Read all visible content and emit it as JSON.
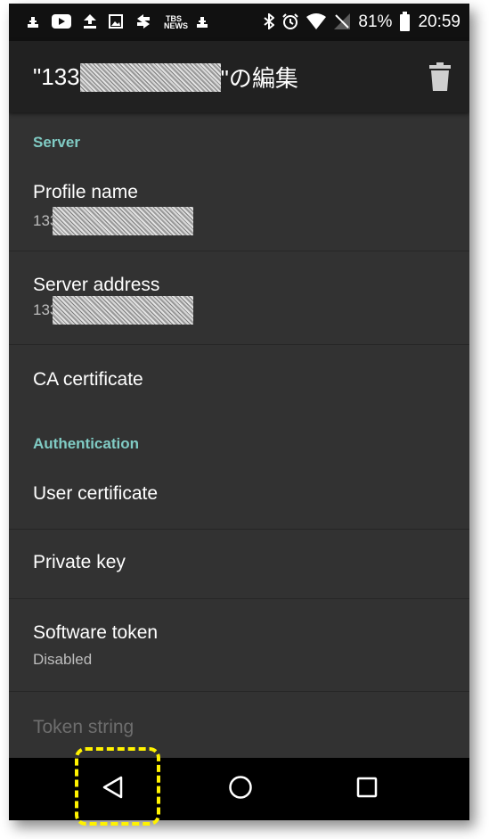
{
  "status_bar": {
    "icons": [
      "notification-icon",
      "youtube-icon",
      "upload-icon",
      "image-icon",
      "sync-icon",
      "tbs-news-icon",
      "notification-icon",
      "bluetooth-icon",
      "alarm-icon",
      "wifi-icon",
      "no-signal-icon",
      "battery-icon"
    ],
    "tbs_label": "TBS NEWS",
    "battery": "81%",
    "time": "20:59"
  },
  "toolbar": {
    "title_prefix": "\"133",
    "title_suffix": "\"の編集",
    "delete_icon": "trash-icon"
  },
  "sections": {
    "server": {
      "header": "Server"
    },
    "auth": {
      "header": "Authentication"
    }
  },
  "items": {
    "profile_name": {
      "title": "Profile name",
      "value_prefix": "133"
    },
    "server_address": {
      "title": "Server address",
      "value_prefix": "133"
    },
    "ca_certificate": {
      "title": "CA certificate"
    },
    "user_certificate": {
      "title": "User certificate"
    },
    "private_key": {
      "title": "Private key"
    },
    "software_token": {
      "title": "Software token",
      "value": "Disabled"
    },
    "token_string": {
      "title": "Token string"
    }
  },
  "nav": {
    "back": "back-icon",
    "home": "home-icon",
    "recents": "recents-icon"
  },
  "colors": {
    "section_header": "#80cbc4",
    "highlight": "#fff200"
  }
}
